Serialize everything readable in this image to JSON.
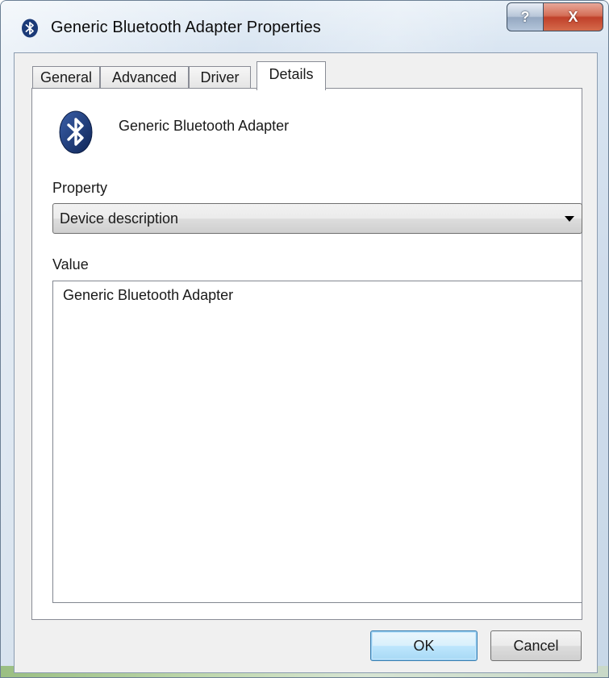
{
  "window": {
    "title": "Generic Bluetooth Adapter Properties",
    "help_label": "?",
    "close_label": "X"
  },
  "tabs": [
    {
      "label": "General"
    },
    {
      "label": "Advanced"
    },
    {
      "label": "Driver"
    },
    {
      "label": "Details"
    }
  ],
  "active_tab": "Details",
  "device": {
    "name": "Generic Bluetooth Adapter",
    "icon": "bluetooth-icon"
  },
  "property": {
    "label": "Property",
    "selected": "Device description"
  },
  "value": {
    "label": "Value",
    "items": [
      "Generic Bluetooth Adapter"
    ]
  },
  "buttons": {
    "ok": "OK",
    "cancel": "Cancel"
  },
  "colors": {
    "bluetooth": "#1b3a78",
    "close_button": "#c0402a",
    "default_button_border": "#3c7fb1"
  }
}
